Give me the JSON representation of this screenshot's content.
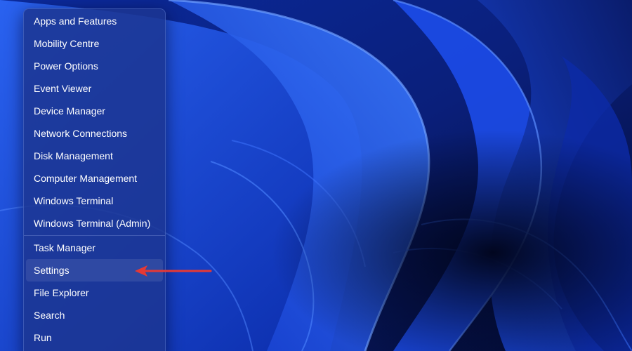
{
  "context_menu": {
    "group1": [
      {
        "id": "apps-and-features",
        "label": "Apps and Features"
      },
      {
        "id": "mobility-centre",
        "label": "Mobility Centre"
      },
      {
        "id": "power-options",
        "label": "Power Options"
      },
      {
        "id": "event-viewer",
        "label": "Event Viewer"
      },
      {
        "id": "device-manager",
        "label": "Device Manager"
      },
      {
        "id": "network-connections",
        "label": "Network Connections"
      },
      {
        "id": "disk-management",
        "label": "Disk Management"
      },
      {
        "id": "computer-management",
        "label": "Computer Management"
      },
      {
        "id": "windows-terminal",
        "label": "Windows Terminal"
      },
      {
        "id": "windows-terminal-admin",
        "label": "Windows Terminal (Admin)"
      }
    ],
    "group2": [
      {
        "id": "task-manager",
        "label": "Task Manager"
      },
      {
        "id": "settings",
        "label": "Settings",
        "highlighted": true
      },
      {
        "id": "file-explorer",
        "label": "File Explorer"
      },
      {
        "id": "search",
        "label": "Search"
      },
      {
        "id": "run",
        "label": "Run"
      }
    ]
  },
  "annotation": {
    "arrow_icon": "left-arrow-icon",
    "arrow_color": "#e53935",
    "points_to": "settings"
  },
  "colors": {
    "menu_background": "#1c3592",
    "menu_text": "#ffffff",
    "wallpaper_primary": "#1a47e6",
    "wallpaper_dark": "#04103f"
  }
}
